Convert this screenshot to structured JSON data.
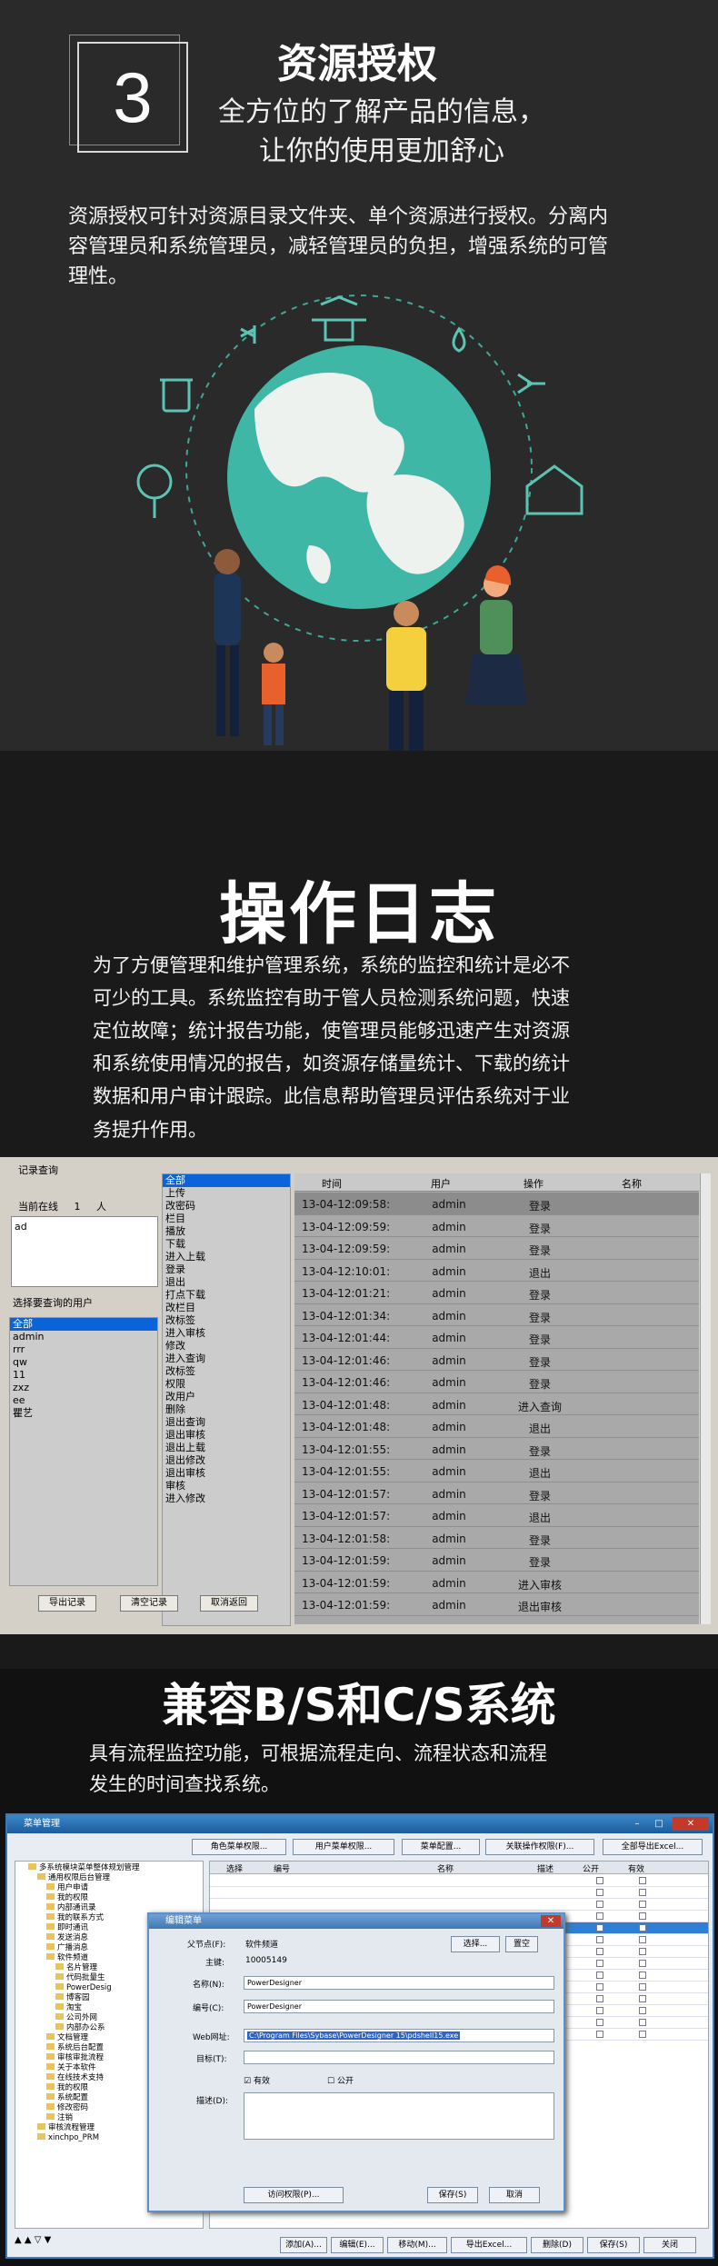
{
  "resource": {
    "number": "3",
    "title": "资源授权",
    "subtitle1": "全方位的了解产品的信息，",
    "subtitle2": "让你的使用更加舒心",
    "para1": "资源授权可针对资源目录文件夹、单个资源进行授权。分离内",
    "para2": "容管理员和系统管理员，减轻管理员的负担，增强系统的可管",
    "para3": "理性。"
  },
  "oplog": {
    "title": "操作日志",
    "lines": [
      "为了方便管理和维护管理系统，系统的监控和统计是必不",
      "可少的工具。系统监控有助于管人员检测系统问题，快速",
      "定位故障；统计报告功能，使管理员能够迅速产生对资源",
      "和系统使用情况的报告，如资源存储量统计、下载的统计",
      "数据和用户审计跟踪。此信息帮助管理员评估系统对于业",
      "务提升作用。"
    ]
  },
  "log_window": {
    "title": "记录查询",
    "online_label": "当前在线",
    "online_count": "1",
    "online_unit": "人",
    "online_users": [
      "ad"
    ],
    "select_user_label": "选择要查询的用户",
    "users": [
      "全部",
      "admin",
      "rrr",
      "qw",
      "11",
      "zxz",
      "ee",
      "瞿艺"
    ],
    "actions": [
      "全部",
      "上传",
      "改密码",
      "栏目",
      "播放",
      "下载",
      "进入上载",
      "登录",
      "退出",
      "打点下载",
      "改栏目",
      "改标签",
      "进入审核",
      "修改",
      "进入查询",
      "改标签",
      "权限",
      "改用户",
      "删除",
      "退出查询",
      "退出审核",
      "退出上载",
      "退出修改",
      "退出审核",
      "审核",
      "进入修改"
    ],
    "buttons": {
      "export": "导出记录",
      "clear": "清空记录",
      "back": "取消返回"
    },
    "columns": [
      "时间",
      "用户",
      "操作",
      "名称"
    ],
    "rows": [
      [
        "13-04-12:09:58:",
        "admin",
        "登录"
      ],
      [
        "13-04-12:09:59:",
        "admin",
        "登录"
      ],
      [
        "13-04-12:09:59:",
        "admin",
        "登录"
      ],
      [
        "13-04-12:10:01:",
        "admin",
        "退出"
      ],
      [
        "13-04-12:01:21:",
        "admin",
        "登录"
      ],
      [
        "13-04-12:01:34:",
        "admin",
        "登录"
      ],
      [
        "13-04-12:01:44:",
        "admin",
        "登录"
      ],
      [
        "13-04-12:01:46:",
        "admin",
        "登录"
      ],
      [
        "13-04-12:01:46:",
        "admin",
        "登录"
      ],
      [
        "13-04-12:01:48:",
        "admin",
        "进入查询"
      ],
      [
        "13-04-12:01:48:",
        "admin",
        "退出"
      ],
      [
        "13-04-12:01:55:",
        "admin",
        "登录"
      ],
      [
        "13-04-12:01:55:",
        "admin",
        "退出"
      ],
      [
        "13-04-12:01:57:",
        "admin",
        "登录"
      ],
      [
        "13-04-12:01:57:",
        "admin",
        "退出"
      ],
      [
        "13-04-12:01:58:",
        "admin",
        "登录"
      ],
      [
        "13-04-12:01:59:",
        "admin",
        "登录"
      ],
      [
        "13-04-12:01:59:",
        "admin",
        "进入审核"
      ],
      [
        "13-04-12:01:59:",
        "admin",
        "退出审核"
      ]
    ]
  },
  "compat": {
    "title": "兼容B/S和C/S系统",
    "line1": "具有流程监控功能，可根据流程走向、流程状态和流程",
    "line2": "发生的时间查找系统。"
  },
  "menu_window": {
    "title": "菜单管理",
    "toolbar": [
      "角色菜单权限...",
      "用户菜单权限...",
      "菜单配置...",
      "关联操作权限(F)...",
      "全部导出Excel..."
    ],
    "tree": [
      "多系统模块菜单整体规划管理",
      "通用权限后台管理",
      "用户申请",
      "我的权限",
      "内部通讯录",
      "我的联系方式",
      "即时通讯",
      "发送消息",
      "广播消息",
      "软件频道",
      "名片管理",
      "代码批量生",
      "PowerDesig",
      "博客园",
      "淘宝",
      "公司外网",
      "内部办公系",
      "文档管理",
      "系统后台配置",
      "审核审批流程",
      "关于本软件",
      "在线技术支持",
      "我的权限",
      "系统配置",
      "修改密码",
      "注销",
      "审核流程管理",
      "xinchpo_PRM"
    ],
    "grid_cols": [
      "选择",
      "编号",
      "名称",
      "描述",
      "公开",
      "有效"
    ],
    "bottom_buttons": [
      "添加(A)...",
      "编辑(E)...",
      "移动(M)...",
      "导出Excel...",
      "删除(D)",
      "保存(S)",
      "关闭"
    ],
    "dialog": {
      "title": "编辑菜单",
      "parent_label": "父节点(F):",
      "parent_value": "软件频道",
      "select": "选择...",
      "clear": "置空",
      "key_label": "主键:",
      "key_value": "10005149",
      "name_label": "名称(N):",
      "name_value": "PowerDesigner",
      "code_label": "编号(C):",
      "code_value": "PowerDesigner",
      "url_label": "Web网址:",
      "url_value": "C:\\Program Files\\Sybase\\PowerDesigner 15\\pdshell15.exe",
      "target_label": "目标(T):",
      "valid": "有效",
      "public": "公开",
      "desc_label": "描述(D):",
      "access": "访问权限(P)...",
      "save": "保存(S)",
      "cancel": "取消"
    }
  }
}
